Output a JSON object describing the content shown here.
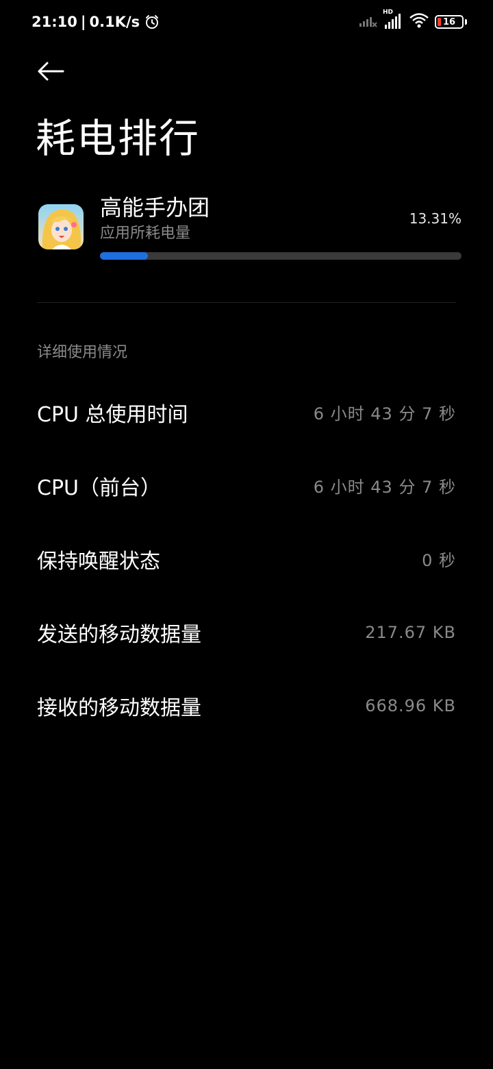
{
  "status_bar": {
    "time": "21:10",
    "separator": "|",
    "network_speed": "0.1K/s",
    "alarm_icon": "alarm-clock-icon",
    "signal_icons": [
      "cellular-signal-weak-icon",
      "cellular-signal-hd-icon",
      "wifi-icon"
    ],
    "hd_label": "HD",
    "battery_level": "16",
    "battery_color": "#ff3b30"
  },
  "header": {
    "back_icon": "arrow-left-icon",
    "title": "耗电排行"
  },
  "app": {
    "name": "高能手办团",
    "subtitle": "应用所耗电量",
    "percent": "13.31%",
    "progress_fraction": 0.1331,
    "progress_color": "#1f6fde"
  },
  "details": {
    "section_label": "详细使用情况",
    "rows": [
      {
        "label": "CPU 总使用时间",
        "value": "6 小时 43 分 7 秒"
      },
      {
        "label": "CPU（前台）",
        "value": "6 小时 43 分 7 秒"
      },
      {
        "label": "保持唤醒状态",
        "value": "0 秒"
      },
      {
        "label": "发送的移动数据量",
        "value": "217.67 KB"
      },
      {
        "label": "接收的移动数据量",
        "value": "668.96 KB"
      }
    ]
  }
}
